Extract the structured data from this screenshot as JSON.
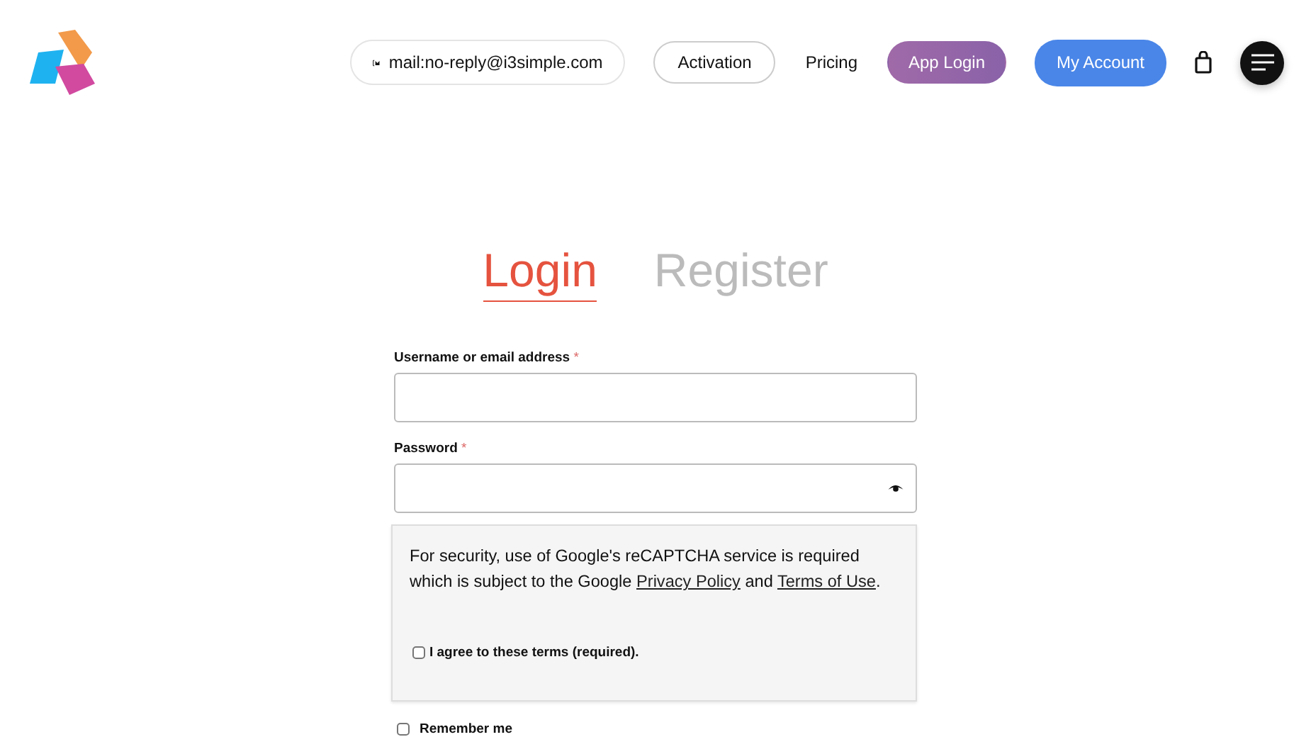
{
  "header": {
    "email": "mail:no-reply@i3simple.com",
    "nav": [
      {
        "label": "Activation",
        "kind": "outline"
      },
      {
        "label": "Pricing",
        "kind": "plain"
      },
      {
        "label": "App Login",
        "kind": "gradient"
      },
      {
        "label": "My Account",
        "kind": "primary"
      }
    ]
  },
  "tabs": [
    {
      "label": "Login",
      "selected": true
    },
    {
      "label": "Register",
      "selected": false
    }
  ],
  "fields": [
    {
      "label": "Username or email address",
      "required": "*",
      "kind": "text"
    },
    {
      "label": "Password",
      "required": "*",
      "kind": "password"
    }
  ],
  "captcha": {
    "text_before": "For security, use of Google's reCAPTCHA service is required which is subject to the Google",
    "privacy_link": "Privacy Policy",
    "text_middle": "and",
    "terms_link": "Terms of Use",
    "text_after": ".",
    "agree_label": "I agree to these terms (required).",
    "agree_checked": false
  },
  "remember": {
    "label": "Remember me",
    "checked": false
  }
}
